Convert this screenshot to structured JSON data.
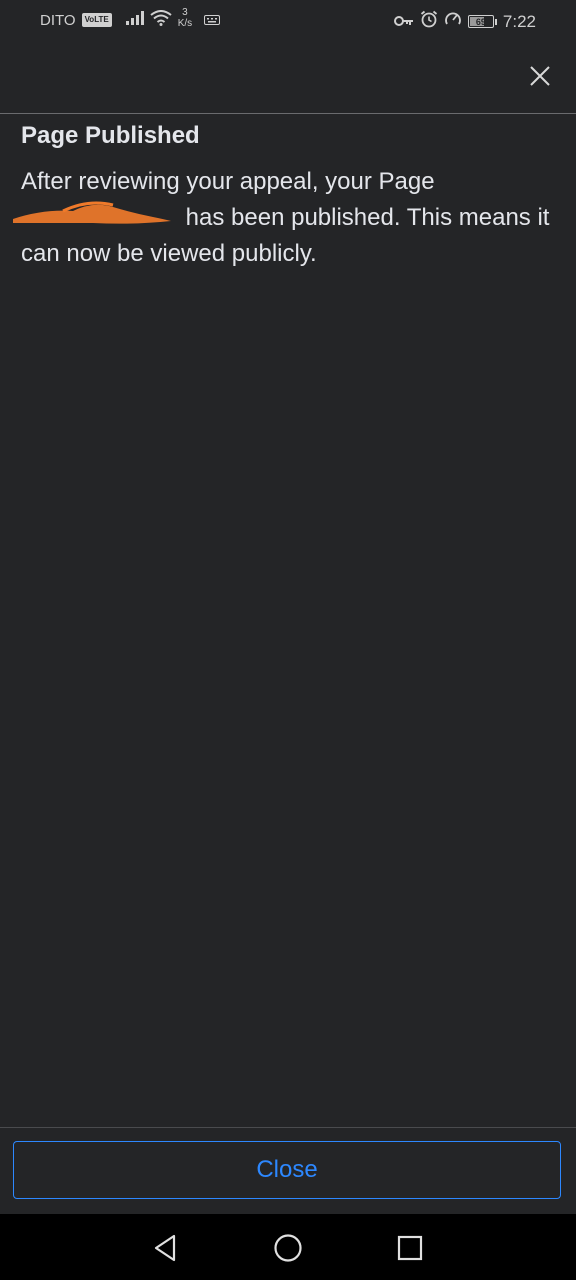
{
  "status_bar": {
    "carrier": "DITO",
    "volte": "VoLTE",
    "speed_value": "3",
    "speed_unit": "K/s",
    "battery": "69",
    "time": "7:22"
  },
  "dialog": {
    "title": "Page Published",
    "body_part1": "After reviewing your appeal, your Page",
    "body_part2": "has been published. This means it can now be viewed publicly."
  },
  "footer": {
    "close_label": "Close"
  },
  "colors": {
    "background": "#242527",
    "text": "#e4e6eb",
    "accent": "#2d88ff",
    "redaction": "#f07a2a"
  }
}
